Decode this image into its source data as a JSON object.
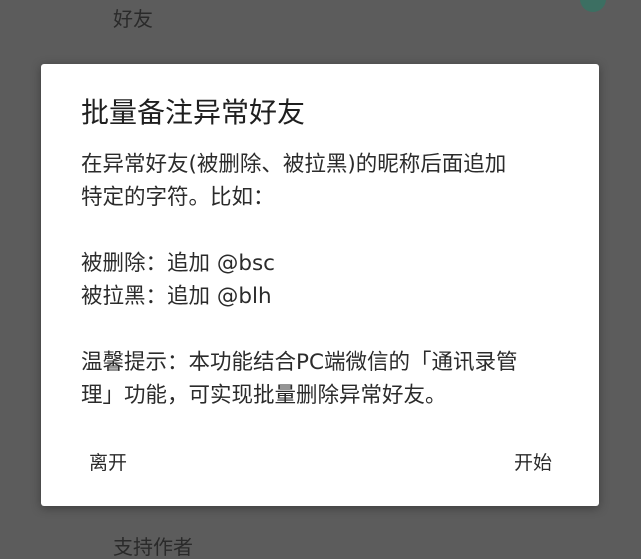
{
  "background": {
    "top_item_label": "好友",
    "bottom_item_label": "支持作者"
  },
  "dialog": {
    "title": "批量备注异常好友",
    "body": {
      "line1": "在异常好友(被删除、被拉黑)的昵称后面追加",
      "line2": "特定的字符。比如：",
      "line3": "被删除：追加 @bsc",
      "line4": "被拉黑：追加 @blh",
      "line5": "温馨提示：本功能结合PC端微信的「通讯录管",
      "line6": "理」功能，可实现批量删除异常好友。"
    },
    "buttons": {
      "leave": "离开",
      "start": "开始"
    }
  },
  "colors": {
    "overlay": "#5c5c5c",
    "dialog_bg": "#ffffff",
    "text": "#2b2b2b"
  }
}
